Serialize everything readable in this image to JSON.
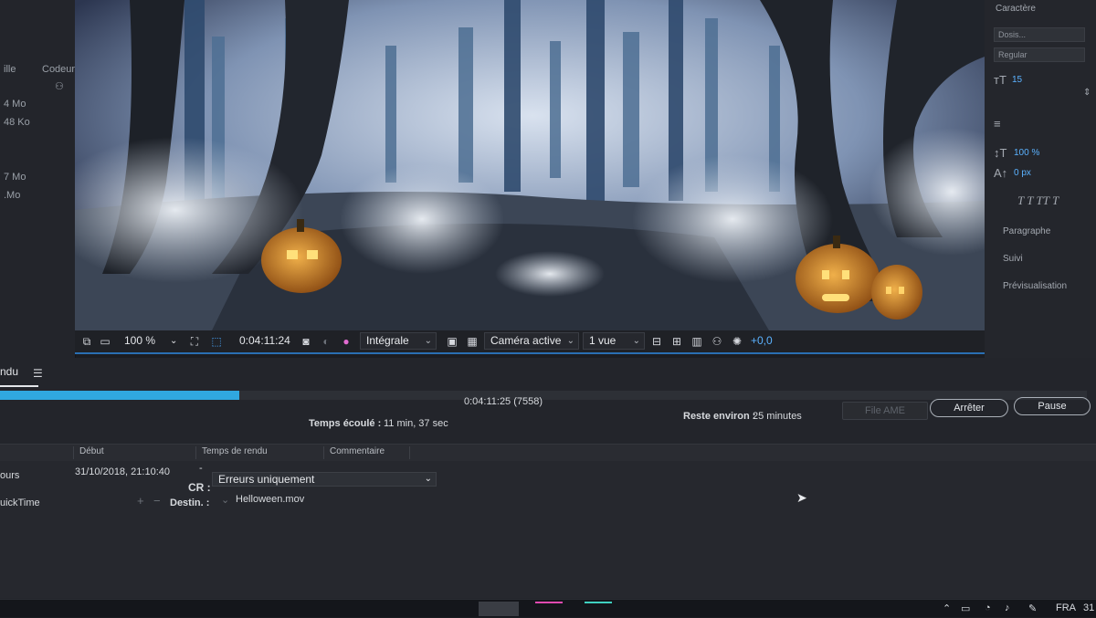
{
  "project_panel": {
    "header_left": "ille",
    "header_right": "Codeur",
    "sizes": [
      "4 Mo",
      "48 Ko",
      "7 Mo",
      ".Mo"
    ]
  },
  "viewer_toolbar": {
    "zoom": "100 %",
    "timecode": "0:04:11:24",
    "resolution": "Intégrale",
    "camera": "Caméra active",
    "views": "1 vue",
    "exposure": "+0,0"
  },
  "right_panel": {
    "title": "Caractère",
    "font_name": "Dosis...",
    "font_style": "Regular",
    "font_size": "15",
    "scale_v": "100 %",
    "baseline": "0 px",
    "paragraph": "Paragraphe",
    "tracking": "Suivi",
    "preview": "Prévisualisation"
  },
  "render_queue": {
    "tab_label": "ndu",
    "progress": 0.22,
    "current_time": "0:04:11:25 (7558)",
    "elapsed_label": "Temps écoulé :",
    "elapsed_value": "11 min, 37 sec",
    "remaining_label": "Reste environ :",
    "remaining_value": "25 minutes",
    "ame_button": "File AME",
    "stop_button": "Arrêter",
    "pause_button": "Pause",
    "columns": [
      "Début",
      "Temps de rendu",
      "Commentaire"
    ],
    "item": {
      "status": "ours",
      "start": "31/10/2018, 21:10:40",
      "render_time": "-",
      "log_label": "CR :",
      "log_value": "Erreurs uniquement",
      "module": "uickTime",
      "output_label": "Destin. :",
      "output_file": "Helloween.mov"
    }
  },
  "taskbar": {
    "language": "FRA",
    "clock": "31"
  },
  "colors": {
    "accent_blue": "#30a8e0",
    "panel_bg": "#23252b"
  }
}
